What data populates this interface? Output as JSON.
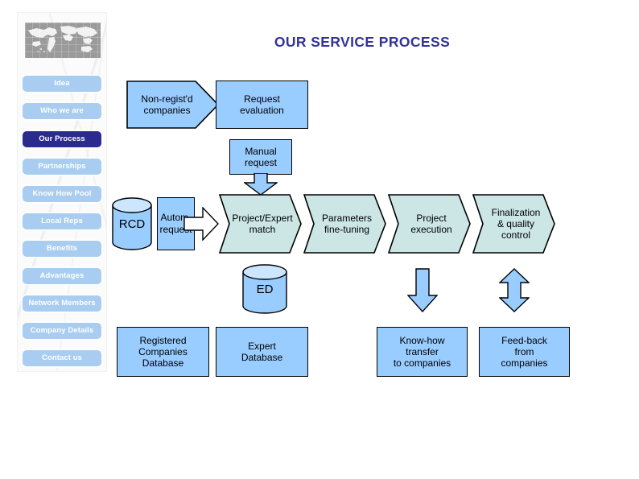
{
  "slide": {
    "title": "OUR SERVICE PROCESS",
    "title_color": "#333399",
    "background": "#ffffff"
  },
  "sidebar": {
    "logo": "world-map-image",
    "active_item": "Our Process",
    "item_color": "#a8cdf0",
    "active_color": "#2b2b8f",
    "items": [
      {
        "label": "Idea",
        "active": false
      },
      {
        "label": "Who we are",
        "active": false
      },
      {
        "label": "Our Process",
        "active": true
      },
      {
        "label": "Partnerships",
        "active": false
      },
      {
        "label": "Know How Pool",
        "active": false
      },
      {
        "label": "Local Reps",
        "active": false
      },
      {
        "label": "Benefits",
        "active": false
      },
      {
        "label": "Advantages",
        "active": false
      },
      {
        "label": "Network Members",
        "active": false
      },
      {
        "label": "Company Details",
        "active": false
      },
      {
        "label": "Contact us",
        "active": false
      }
    ]
  },
  "diagram": {
    "box_fill": "#99ccff",
    "chevron_fill": "#cce6e6",
    "stroke": "#000000",
    "nodes": {
      "non_registered": "Non-regist'd companies",
      "non_registered_l1": "Non-regist'd",
      "non_registered_l2": "companies",
      "request_evaluation_l1": "Request",
      "request_evaluation_l2": "evaluation",
      "manual_request_l1": "Manual",
      "manual_request_l2": "request",
      "rcd": "RCD",
      "autom_request_l1": "Autom.",
      "autom_request_l2": "request",
      "project_expert_match_l1": "Project/Expert",
      "project_expert_match_l2": "match",
      "parameters_fine_tuning_l1": "Parameters",
      "parameters_fine_tuning_l2": "fine-tuning",
      "project_execution_l1": "Project",
      "project_execution_l2": "execution",
      "finalization_l1": "Finalization",
      "finalization_l2": "& quality",
      "finalization_l3": "control",
      "ed": "ED",
      "registered_companies_db_l1": "Registered",
      "registered_companies_db_l2": "Companies",
      "registered_companies_db_l3": "Database",
      "expert_db_l1": "Expert",
      "expert_db_l2": "Database",
      "knowhow_transfer_l1": "Know-how",
      "knowhow_transfer_l2": "transfer",
      "knowhow_transfer_l3": "to companies",
      "feedback_l1": "Feed-back",
      "feedback_l2": "from",
      "feedback_l3": "companies"
    }
  }
}
